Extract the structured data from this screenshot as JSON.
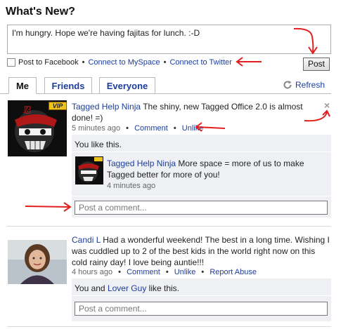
{
  "header": {
    "title": "What's New?"
  },
  "status_box": {
    "value": "I'm hungry.  Hope we're having fajitas for lunch.   :-D"
  },
  "share": {
    "facebook_label": "Post to Facebook",
    "myspace_label": "Connect to MySpace",
    "twitter_label": "Connect to Twitter"
  },
  "post_button": "Post",
  "tabs": [
    {
      "label": "Me"
    },
    {
      "label": "Friends"
    },
    {
      "label": "Everyone"
    }
  ],
  "refresh_label": "Refresh",
  "feed": [
    {
      "author": "Tagged Help Ninja",
      "badge": "VIP",
      "text": "The shiny, new Tagged Office 2.0 is almost done! =)",
      "time": "5 minutes ago",
      "comment_label": "Comment",
      "unlike_label": "Unlike",
      "likes_text": "You like this.",
      "close": "×",
      "reply": {
        "author": "Tagged Help Ninja",
        "text": "More space = more of us to make Tagged better for more of you!",
        "time": "4 minutes ago"
      },
      "comment_placeholder": "Post a comment..."
    },
    {
      "author": "Candi L",
      "text": "Had a wonderful weekend! The best in a long time. Wishing I was cuddled up to 2 of the best kids in the world right now on this cold rainy day! I love being auntie!!!",
      "time": "4 hours ago",
      "comment_label": "Comment",
      "unlike_label": "Unlike",
      "report_label": "Report Abuse",
      "likes_prefix": "You and ",
      "likes_friend": "Lover Guy",
      "likes_suffix": " like this.",
      "comment_placeholder": "Post a comment..."
    }
  ],
  "colors": {
    "link": "#1d3d9c",
    "annotation": "#e0201e",
    "likes_bg": "#eef0f3"
  }
}
